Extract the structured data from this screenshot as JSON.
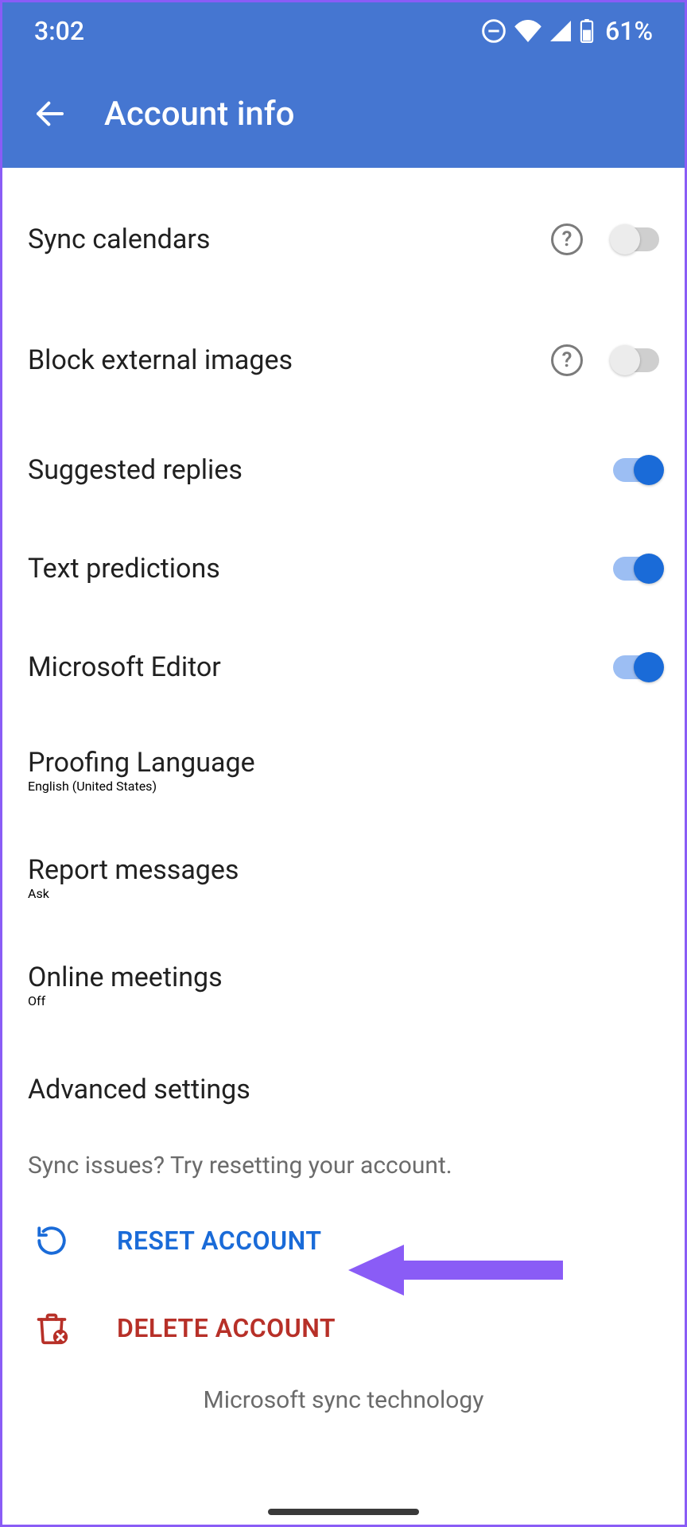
{
  "status": {
    "time": "3:02",
    "battery_pct": "61%"
  },
  "header": {
    "title": "Account info"
  },
  "settings": {
    "sync_calendars": {
      "label": "Sync calendars",
      "help": true,
      "on": false
    },
    "block_external_images": {
      "label": "Block external images",
      "help": true,
      "on": false
    },
    "suggested_replies": {
      "label": "Suggested replies",
      "help": false,
      "on": true
    },
    "text_predictions": {
      "label": "Text predictions",
      "help": false,
      "on": true
    },
    "microsoft_editor": {
      "label": "Microsoft Editor",
      "help": false,
      "on": true
    },
    "proofing_language": {
      "label": "Proofing Language",
      "value": "English (United States)"
    },
    "report_messages": {
      "label": "Report messages",
      "value": "Ask"
    },
    "online_meetings": {
      "label": "Online meetings",
      "value": "Off"
    },
    "advanced_settings": {
      "label": "Advanced settings"
    }
  },
  "hint": "Sync issues? Try resetting your account.",
  "actions": {
    "reset": {
      "label": "RESET ACCOUNT"
    },
    "delete": {
      "label": "DELETE ACCOUNT"
    }
  },
  "footer": "Microsoft sync technology",
  "colors": {
    "accent": "#1a6bd8",
    "header_bg": "#4576d1",
    "danger": "#b73028",
    "annotation": "#8a5cf6"
  }
}
